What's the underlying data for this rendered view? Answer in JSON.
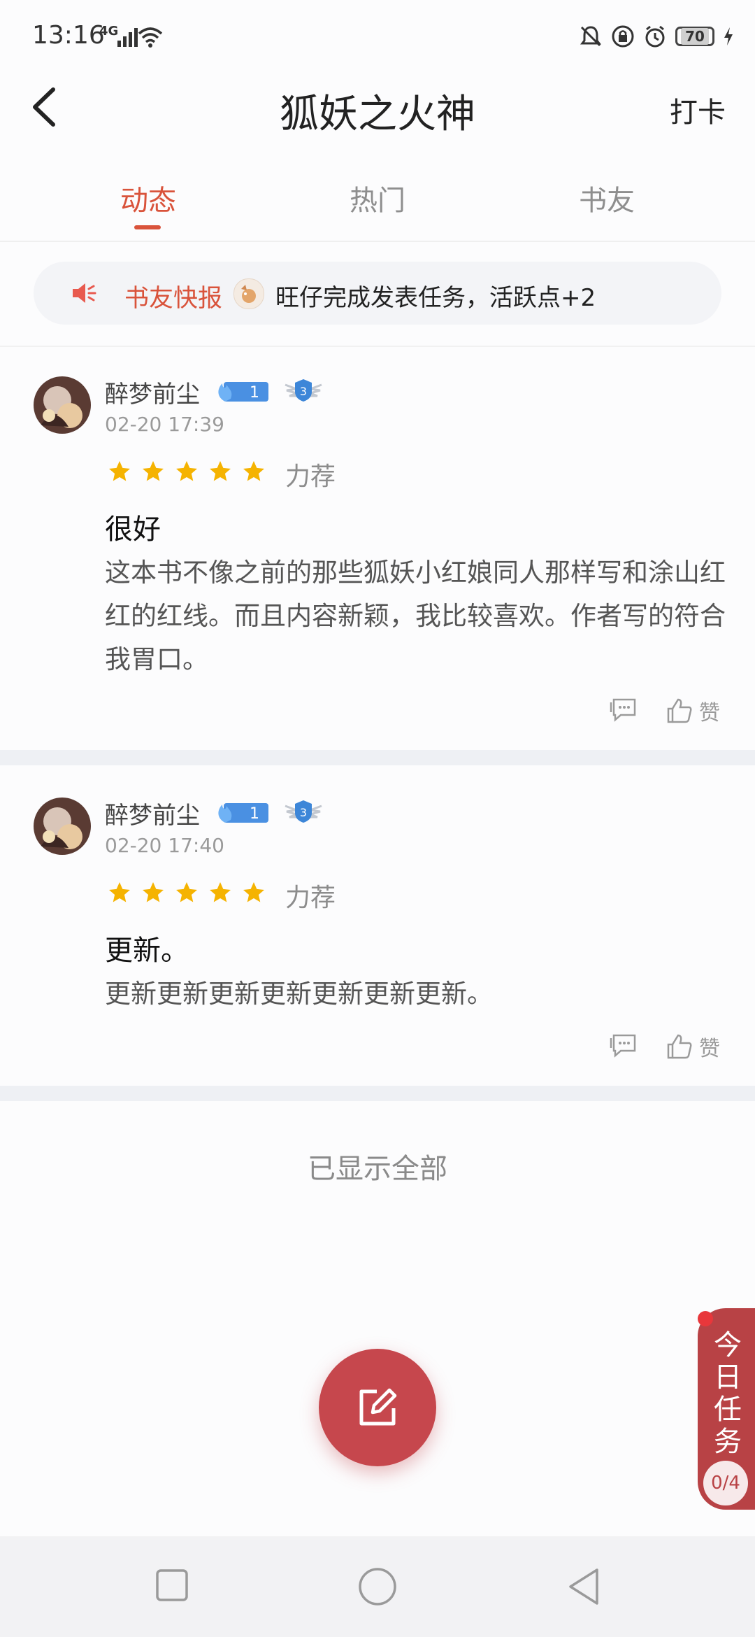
{
  "status_bar": {
    "time": "13:16",
    "network": "4G",
    "battery": "70"
  },
  "header": {
    "title": "狐妖之火神",
    "action": "打卡"
  },
  "tabs": [
    {
      "label": "动态",
      "active": true
    },
    {
      "label": "热门",
      "active": false
    },
    {
      "label": "书友",
      "active": false
    }
  ],
  "ticker": {
    "label": "书友快报",
    "text": "旺仔完成发表任务，活跃点+2"
  },
  "posts": [
    {
      "user": "醉梦前尘",
      "fire_level": "1",
      "rank_level": "3",
      "time": "02-20 17:39",
      "rating": 5,
      "rating_label": "力荐",
      "title": "很好",
      "body": "这本书不像之前的那些狐妖小红娘同人那样写和涂山红红的红线。而且内容新颖，我比较喜欢。作者写的符合我胃口。",
      "like_label": "赞"
    },
    {
      "user": "醉梦前尘",
      "fire_level": "1",
      "rank_level": "3",
      "time": "02-20 17:40",
      "rating": 5,
      "rating_label": "力荐",
      "title": "更新。",
      "body": "更新更新更新更新更新更新更新。",
      "like_label": "赞"
    }
  ],
  "end_text": "已显示全部",
  "daily_task": {
    "title": "今日任务",
    "count": "0/4"
  },
  "colors": {
    "accent": "#d9533b",
    "fab": "#c6474d",
    "star": "#f5b301",
    "task_tab": "#b84245"
  }
}
